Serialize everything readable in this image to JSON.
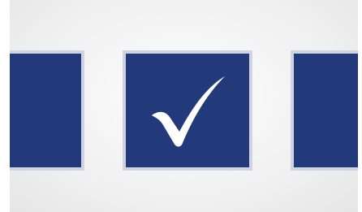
{
  "tiles": [
    {
      "id": "left",
      "selected": false
    },
    {
      "id": "center",
      "selected": true
    },
    {
      "id": "right",
      "selected": false
    }
  ],
  "colors": {
    "tile_fill": "#223a7a",
    "tile_border": "#cfd3e3",
    "check": "#ffffff",
    "background": "#f1f1f1"
  },
  "icons": {
    "selected_marker": "checkmark-icon"
  }
}
